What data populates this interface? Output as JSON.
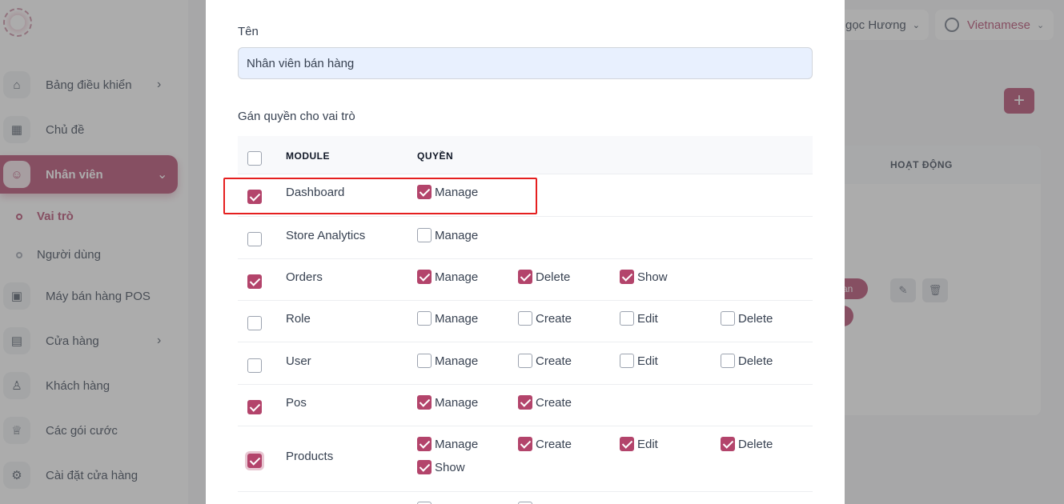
{
  "sidebar": {
    "items": [
      {
        "label": "Bảng điều khiển",
        "icon": "home-icon",
        "has_chevron": true
      },
      {
        "label": "Chủ đề",
        "icon": "grid-icon",
        "has_chevron": false
      },
      {
        "label": "Nhân viên",
        "icon": "users-icon",
        "has_chevron": true,
        "active": true
      },
      {
        "label": "Máy bán hàng POS",
        "icon": "pos-icon",
        "has_chevron": false
      },
      {
        "label": "Cửa hàng",
        "icon": "store-icon",
        "has_chevron": true
      },
      {
        "label": "Khách hàng",
        "icon": "user-icon",
        "has_chevron": false
      },
      {
        "label": "Các gói cước",
        "icon": "trophy-icon",
        "has_chevron": false
      },
      {
        "label": "Cài đặt cửa hàng",
        "icon": "gear-icon",
        "has_chevron": false
      }
    ],
    "sub_items": [
      {
        "label": "Vai trò",
        "active": true
      },
      {
        "label": "Người dùng",
        "active": false
      }
    ]
  },
  "header": {
    "user_name": "gọc Hương",
    "language": "Vietnamese"
  },
  "background_table": {
    "action_header": "HOẠT ĐỘNG",
    "pill_text": "an"
  },
  "modal": {
    "name_label": "Tên",
    "name_value": "Nhân viên bán hàng",
    "section_title": "Gán quyền cho vai trò",
    "col_module": "MODULE",
    "col_permission": "QUYỀN",
    "rows": [
      {
        "module": "Dashboard",
        "checked": true,
        "perms": [
          {
            "label": "Manage",
            "checked": true
          }
        ]
      },
      {
        "module": "Store Analytics",
        "checked": false,
        "perms": [
          {
            "label": "Manage",
            "checked": false
          }
        ]
      },
      {
        "module": "Orders",
        "checked": true,
        "perms": [
          {
            "label": "Manage",
            "checked": true
          },
          {
            "label": "Delete",
            "checked": true
          },
          {
            "label": "Show",
            "checked": true
          }
        ]
      },
      {
        "module": "Role",
        "checked": false,
        "perms": [
          {
            "label": "Manage",
            "checked": false
          },
          {
            "label": "Create",
            "checked": false
          },
          {
            "label": "Edit",
            "checked": false
          },
          {
            "label": "Delete",
            "checked": false
          }
        ]
      },
      {
        "module": "User",
        "checked": false,
        "perms": [
          {
            "label": "Manage",
            "checked": false
          },
          {
            "label": "Create",
            "checked": false
          },
          {
            "label": "Edit",
            "checked": false
          },
          {
            "label": "Delete",
            "checked": false
          }
        ]
      },
      {
        "module": "Pos",
        "checked": true,
        "perms": [
          {
            "label": "Manage",
            "checked": true
          },
          {
            "label": "Create",
            "checked": true
          }
        ]
      },
      {
        "module": "Products",
        "checked": true,
        "perms": [
          {
            "label": "Manage",
            "checked": true
          },
          {
            "label": "Create",
            "checked": true
          },
          {
            "label": "Edit",
            "checked": true
          },
          {
            "label": "Delete",
            "checked": true
          },
          {
            "label": "Show",
            "checked": true
          }
        ]
      }
    ]
  },
  "colors": {
    "accent": "#b3446b",
    "highlight_box": "#e51f1f"
  }
}
